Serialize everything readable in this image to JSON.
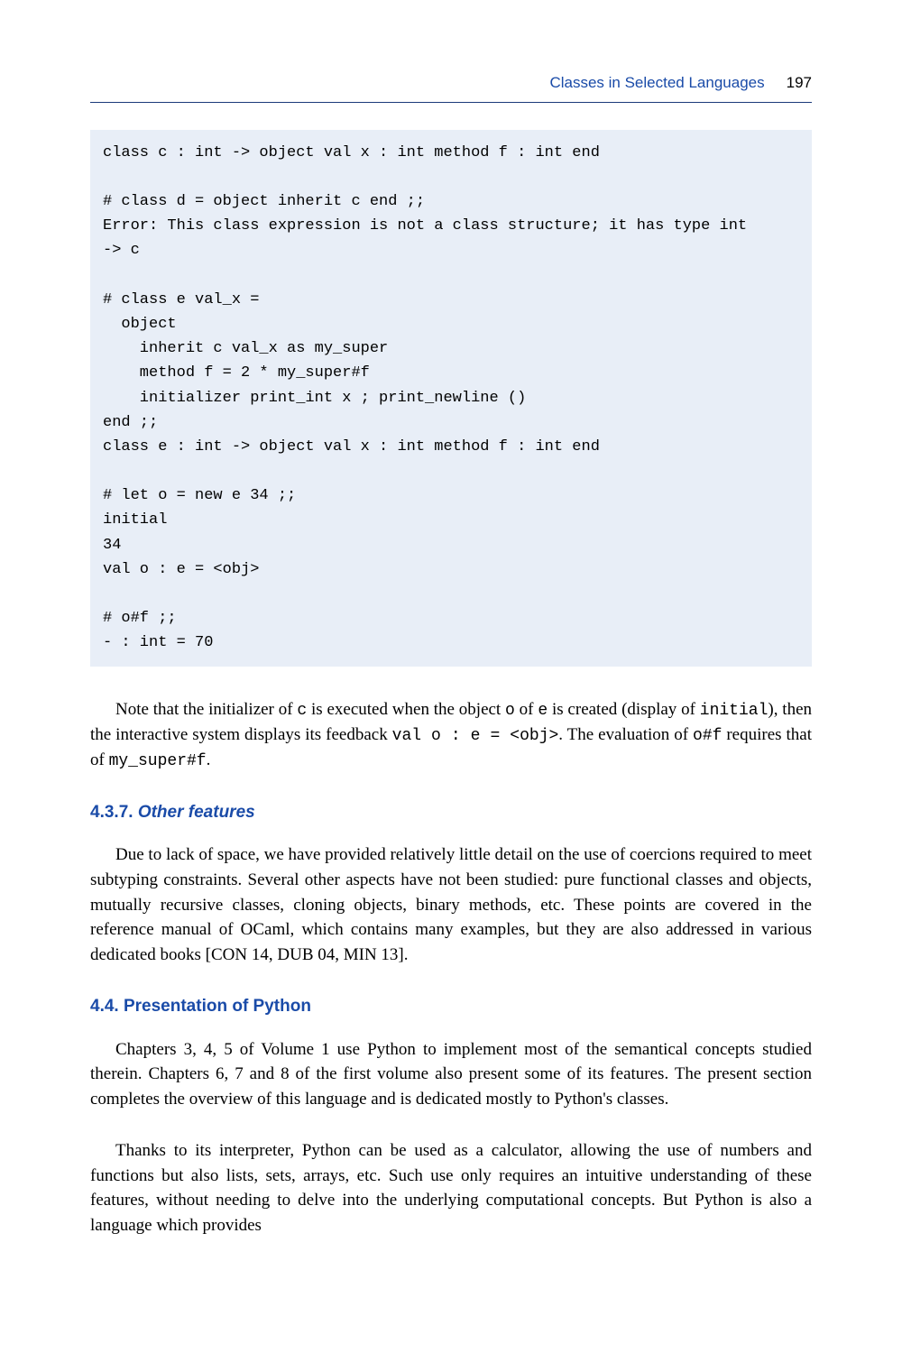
{
  "header": {
    "title": "Classes in Selected Languages",
    "page_number": "197"
  },
  "code_block": "class c : int -> object val x : int method f : int end\n\n# class d = object inherit c end ;;\nError: This class expression is not a class structure; it has type int\n-> c\n\n# class e val_x =\n  object\n    inherit c val_x as my_super\n    method f = 2 * my_super#f\n    initializer print_int x ; print_newline ()\nend ;;\nclass e : int -> object val x : int method f : int end\n\n# let o = new e 34 ;;\ninitial\n34\nval o : e = <obj>\n\n# o#f ;;\n- : int = 70",
  "para1": {
    "t1": "Note that the initializer of ",
    "c1": "c",
    "t2": " is executed when the object ",
    "c2": "o",
    "t3": " of ",
    "c3": "e",
    "t4": " is created (display of ",
    "c4": "initial",
    "t5": "), then the interactive system displays its feedback ",
    "c5": "val o :  e = <obj>",
    "t6": ". The evaluation of ",
    "c6": "o#f",
    "t7": " requires that of ",
    "c7": "my_super#f",
    "t8": "."
  },
  "section437": {
    "number": "4.3.7.",
    "title": "Other features"
  },
  "para2": "Due to lack of space, we have provided relatively little detail on the use of coercions required to meet subtyping constraints. Several other aspects have not been studied: pure functional classes and objects, mutually recursive classes, cloning objects, binary methods, etc. These points are covered in the reference manual of OCaml, which contains many examples, but they are also addressed in various dedicated books [CON 14, DUB 04, MIN 13].",
  "section44": {
    "number": "4.4.",
    "title": "Presentation of Python"
  },
  "para3": "Chapters 3, 4, 5 of Volume 1 use Python to implement most of the semantical concepts studied therein. Chapters 6, 7 and 8 of the first volume also present some of its features. The present section completes the overview of this language and is dedicated mostly to Python's classes.",
  "para4": "Thanks to its interpreter, Python can be used as a calculator, allowing the use of numbers and functions but also lists, sets, arrays, etc. Such use only requires an intuitive understanding of these features, without needing to delve into the underlying computational concepts. But Python is also a language which provides"
}
